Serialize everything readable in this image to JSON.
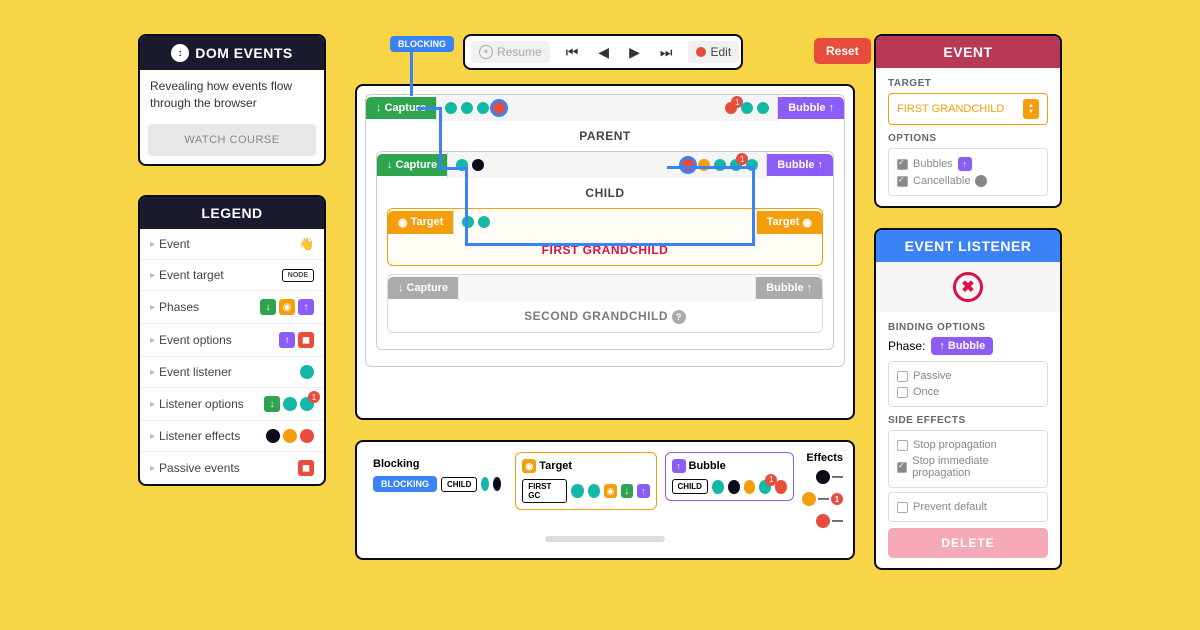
{
  "dom_events": {
    "title": "DOM EVENTS",
    "description": "Revealing how events flow through the browser",
    "cta": "WATCH COURSE"
  },
  "legend": {
    "title": "LEGEND",
    "items": [
      {
        "label": "Event",
        "icon": "👋"
      },
      {
        "label": "Event target",
        "icon": "NODE"
      },
      {
        "label": "Phases"
      },
      {
        "label": "Event options"
      },
      {
        "label": "Event listener"
      },
      {
        "label": "Listener options"
      },
      {
        "label": "Listener effects"
      },
      {
        "label": "Passive events"
      }
    ]
  },
  "toolbar": {
    "resume": "Resume",
    "edit": "Edit",
    "reset": "Reset"
  },
  "blocking_tag": "BLOCKING",
  "nodes": {
    "parent": {
      "capture": "Capture",
      "bubble": "Bubble",
      "name": "PARENT"
    },
    "child": {
      "capture": "Capture",
      "bubble": "Bubble",
      "name": "CHILD"
    },
    "grandchild1": {
      "target_left": "Target",
      "target_right": "Target",
      "name": "FIRST GRANDCHILD"
    },
    "grandchild2": {
      "capture": "Capture",
      "bubble": "Bubble",
      "name": "SECOND GRANDCHILD"
    }
  },
  "timeline": {
    "blocking_title": "Blocking",
    "blocking_badge": "BLOCKING",
    "capture_node": "CHILD",
    "target_title": "Target",
    "target_node": "FIRST GC",
    "bubble_title": "Bubble",
    "bubble_node": "CHILD",
    "effects_title": "Effects"
  },
  "event": {
    "title": "EVENT",
    "target_label": "TARGET",
    "target_value": "FIRST GRANDCHILD",
    "options_label": "OPTIONS",
    "bubbles": "Bubbles",
    "cancellable": "Cancellable"
  },
  "listener": {
    "title": "EVENT LISTENER",
    "binding_label": "BINDING OPTIONS",
    "phase_label": "Phase:",
    "phase_value": "Bubble",
    "passive": "Passive",
    "once": "Once",
    "effects_label": "SIDE EFFECTS",
    "stop_prop": "Stop propagation",
    "stop_imm": "Stop immediate propagation",
    "prevent_default": "Prevent default",
    "delete": "DELETE"
  },
  "counts": {
    "parent_bubble_badge": "1",
    "child_bubble_badge": "1",
    "listener_options_badge": "1",
    "timeline_badge": "1"
  }
}
